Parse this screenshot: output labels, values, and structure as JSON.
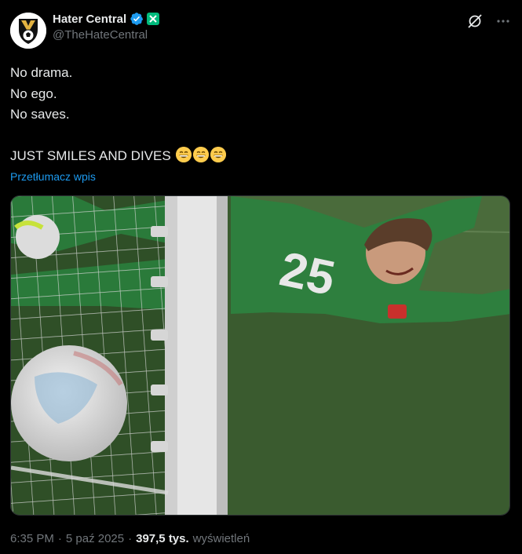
{
  "author": {
    "display_name": "Hater Central",
    "handle": "@TheHateCentral",
    "avatar_icon": "hater-central-logo-icon",
    "verified_color": "#1d9bf0",
    "affiliate_badge_color": "#00ba7c"
  },
  "top_actions": {
    "grok_icon": "grok-icon",
    "more_icon": "more-options-icon"
  },
  "tweet": {
    "lines": [
      "No drama.",
      "No ego.",
      "No saves.",
      "",
      "JUST SMILES AND DIVES"
    ],
    "emoji": [
      "grinning-face",
      "grinning-face",
      "grinning-face"
    ],
    "translate_label": "Przetłumacz wpis"
  },
  "media": {
    "description_icon": "goalkeeper-dive-photo",
    "jersey_number": "25"
  },
  "meta": {
    "time": "6:35 PM",
    "sep1": "·",
    "date": "5 paź 2025",
    "sep2": "·",
    "views_count": "397,5 tys.",
    "views_label": "wyświetleń"
  }
}
